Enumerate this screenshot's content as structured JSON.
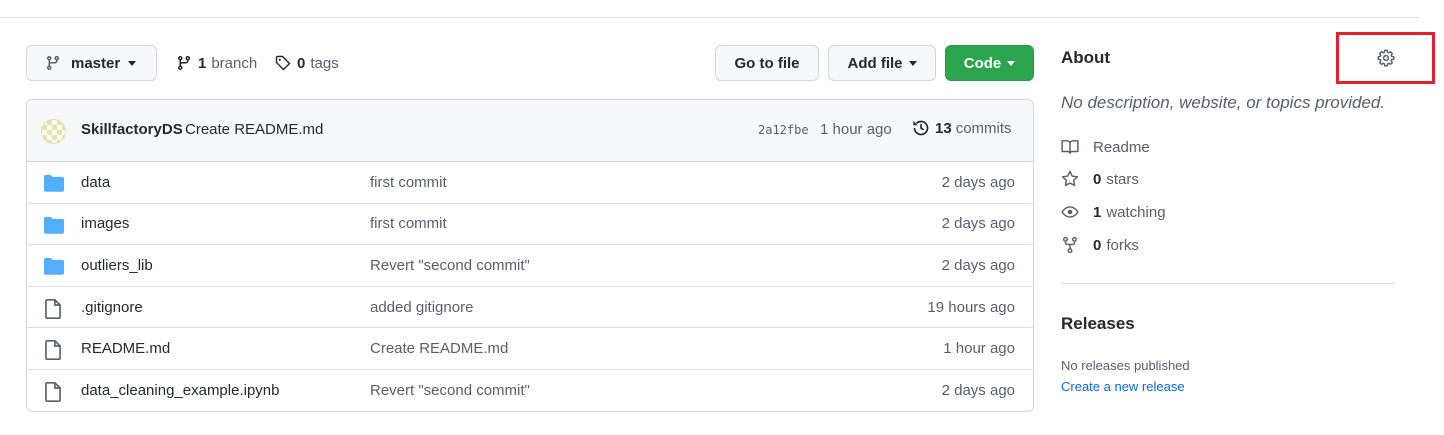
{
  "toolbar": {
    "branch_label": "master",
    "branch_count": "1",
    "branch_word": "branch",
    "tag_count": "0",
    "tag_word": "tags",
    "go_to_file": "Go to file",
    "add_file": "Add file",
    "code": "Code"
  },
  "commit": {
    "author": "SkillfactoryDS",
    "message": "Create README.md",
    "sha": "2a12fbe",
    "time": "1 hour ago",
    "count": "13",
    "count_word": "commits"
  },
  "files": [
    {
      "icon": "folder-icon",
      "name": "data",
      "commit": "first commit",
      "age": "2 days ago"
    },
    {
      "icon": "folder-icon",
      "name": "images",
      "commit": "first commit",
      "age": "2 days ago"
    },
    {
      "icon": "folder-icon",
      "name": "outliers_lib",
      "commit": "Revert \"second commit\"",
      "age": "2 days ago"
    },
    {
      "icon": "file-icon",
      "name": ".gitignore",
      "commit": "added gitignore",
      "age": "19 hours ago"
    },
    {
      "icon": "file-icon",
      "name": "README.md",
      "commit": "Create README.md",
      "age": "1 hour ago"
    },
    {
      "icon": "file-icon",
      "name": "data_cleaning_example.ipynb",
      "commit": "Revert \"second commit\"",
      "age": "2 days ago"
    }
  ],
  "about": {
    "title": "About",
    "description": "No description, website, or topics provided.",
    "readme": "Readme",
    "stars_count": "0",
    "stars_word": "stars",
    "watching_count": "1",
    "watching_word": "watching",
    "forks_count": "0",
    "forks_word": "forks"
  },
  "releases": {
    "title": "Releases",
    "none": "No releases published",
    "create": "Create a new release"
  },
  "colors": {
    "code_button": "#2da44e",
    "highlight_box": "#e3232b",
    "folder": "#54aeff",
    "link": "#0969da"
  }
}
